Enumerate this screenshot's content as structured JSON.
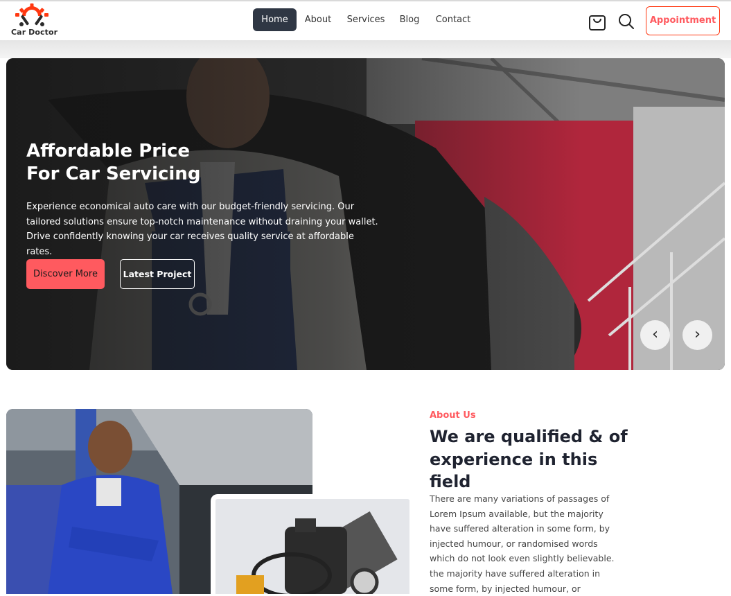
{
  "brand": {
    "name": "Car Doctor",
    "accent": "#ff3811",
    "dark": "#2f3744"
  },
  "nav": {
    "items": [
      {
        "label": "Home",
        "active": true
      },
      {
        "label": "About",
        "active": false
      },
      {
        "label": "Services",
        "active": false
      },
      {
        "label": "Blog",
        "active": false
      },
      {
        "label": "Contact",
        "active": false
      }
    ],
    "cart_icon": "shopping-bag-icon",
    "search_icon": "search-icon",
    "appointment_label": "Appointment"
  },
  "hero": {
    "title_line1": "Affordable Price",
    "title_line2": "For Car Servicing",
    "description": "Experience economical auto care with our budget-friendly servicing. Our tailored solutions ensure top-notch maintenance without draining your wallet. Drive confidently knowing your car receives quality service at affordable rates.",
    "primary_button": "Discover More",
    "secondary_button": "Latest Project",
    "prev_label": "‹",
    "next_label": "›"
  },
  "about": {
    "label": "About Us",
    "title": "We are qualified & of experience in this field",
    "text": "There are many variations of passages of Lorem Ipsum available, but the majority have suffered alteration in some form, by injected humour, or randomised words which do not look even slightly believable. the majority have suffered alteration in some form, by injected humour, or"
  }
}
